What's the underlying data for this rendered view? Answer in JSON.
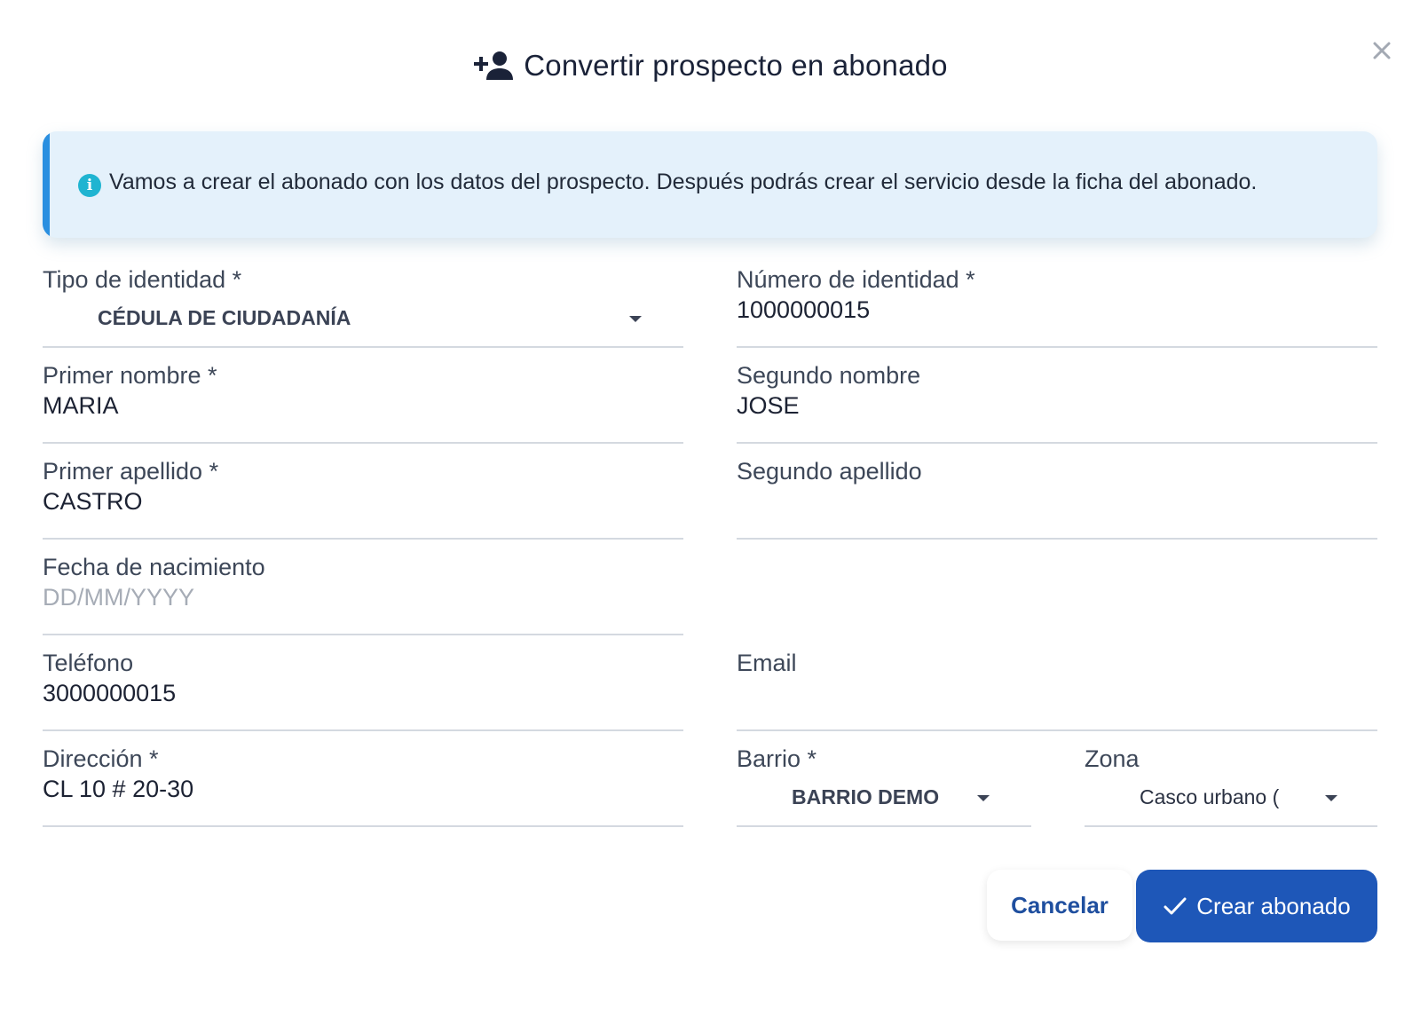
{
  "dialog": {
    "title": "Convertir prospecto en abonado",
    "title_icon": "person-add-icon",
    "close_icon": "close-icon",
    "close_label": "×"
  },
  "banner": {
    "icon": "info-icon",
    "icon_glyph": "i",
    "text": "Vamos a crear el abonado con los datos del prospecto. Después podrás crear el servicio desde la ficha del abonado."
  },
  "form": {
    "tipo_identidad": {
      "label": "Tipo de identidad *",
      "value": "CÉDULA DE CIUDADANÍA"
    },
    "numero_identidad": {
      "label": "Número de identidad *",
      "value": "1000000015"
    },
    "primer_nombre": {
      "label": "Primer nombre *",
      "value": "MARIA"
    },
    "segundo_nombre": {
      "label": "Segundo nombre",
      "value": "JOSE"
    },
    "primer_apellido": {
      "label": "Primer apellido *",
      "value": "CASTRO"
    },
    "segundo_apellido": {
      "label": "Segundo apellido",
      "value": ""
    },
    "fecha_nacimiento": {
      "label": "Fecha de nacimiento",
      "placeholder": "DD/MM/YYYY"
    },
    "telefono": {
      "label": "Teléfono",
      "value": "3000000015"
    },
    "email": {
      "label": "Email",
      "value": ""
    },
    "direccion": {
      "label": "Dirección *",
      "value": "CL 10 # 20-30"
    },
    "barrio": {
      "label": "Barrio *",
      "value": "BARRIO DEMO"
    },
    "zona": {
      "label": "Zona",
      "value": "Casco urbano ("
    }
  },
  "actions": {
    "cancel_label": "Cancelar",
    "submit_label": "Crear abonado",
    "submit_icon": "check-icon"
  },
  "colors": {
    "primary": "#1e57b8",
    "info_accent": "#2a8fe0",
    "info_bg": "#e4f1fb",
    "info_icon": "#1fb4d1"
  }
}
